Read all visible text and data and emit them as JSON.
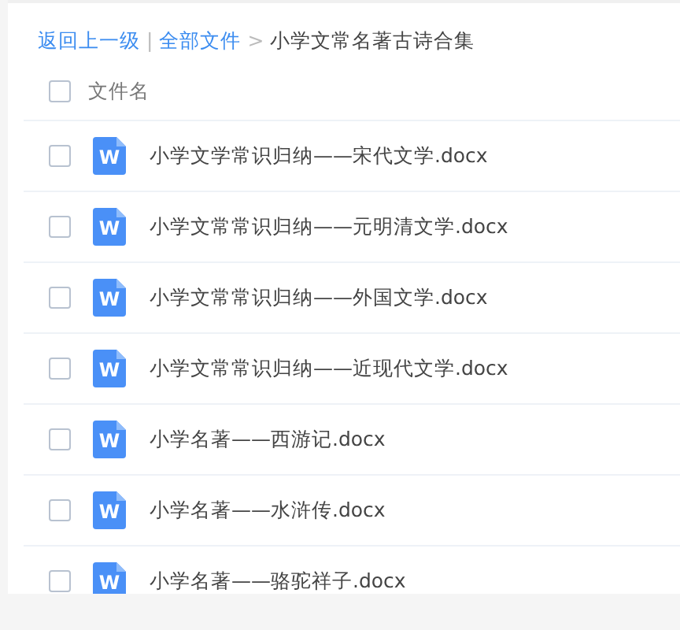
{
  "breadcrumb": [
    {
      "text": "返回上一级",
      "kind": "link"
    },
    {
      "text": "|",
      "kind": "separator"
    },
    {
      "text": "全部文件",
      "kind": "link"
    },
    {
      "text": ">",
      "kind": "separator"
    },
    {
      "text": "小学文常名著古诗合集",
      "kind": "current"
    }
  ],
  "header": {
    "checked": false,
    "label": "文件名"
  },
  "files": [
    {
      "name": "小学文学常识归纳——宋代文学.docx",
      "checked": false,
      "icon_text": "W"
    },
    {
      "name": "小学文常常识归纳——元明清文学.docx",
      "checked": false,
      "icon_text": "W"
    },
    {
      "name": "小学文常常识归纳——外国文学.docx",
      "checked": false,
      "icon_text": "W"
    },
    {
      "name": "小学文常常识归纳——近现代文学.docx",
      "checked": false,
      "icon_text": "W"
    },
    {
      "name": "小学名著——西游记.docx",
      "checked": false,
      "icon_text": "W"
    },
    {
      "name": "小学名著——水浒传.docx",
      "checked": false,
      "icon_text": "W"
    },
    {
      "name": "小学名著——骆驼祥子.docx",
      "checked": false,
      "icon_text": "W"
    }
  ]
}
